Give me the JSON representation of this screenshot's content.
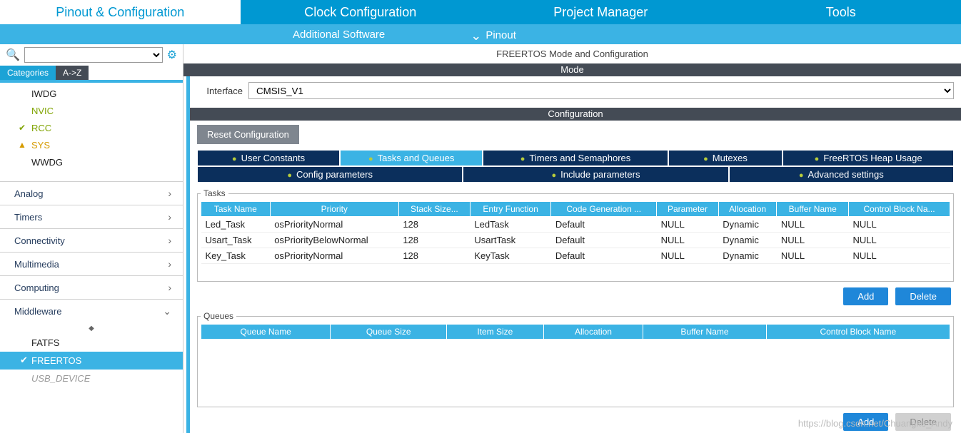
{
  "topTabs": {
    "pinout": "Pinout & Configuration",
    "clock": "Clock Configuration",
    "project": "Project Manager",
    "tools": "Tools"
  },
  "subbar": {
    "additional": "Additional Software",
    "pinout": "Pinout"
  },
  "sidebar": {
    "tabs": {
      "categories": "Categories",
      "az": "A->Z"
    },
    "sysItems": {
      "iwdg": "IWDG",
      "nvic": "NVIC",
      "rcc": "RCC",
      "sys": "SYS",
      "wwdg": "WWDG"
    },
    "categories": {
      "analog": "Analog",
      "timers": "Timers",
      "connectivity": "Connectivity",
      "multimedia": "Multimedia",
      "computing": "Computing",
      "middleware": "Middleware"
    },
    "middlewareItems": {
      "fatfs": "FATFS",
      "freertos": "FREERTOS",
      "usb": "USB_DEVICE"
    }
  },
  "content": {
    "title": "FREERTOS Mode and Configuration",
    "modeHeader": "Mode",
    "interfaceLabel": "Interface",
    "interfaceValue": "CMSIS_V1",
    "configHeader": "Configuration",
    "resetBtn": "Reset Configuration",
    "cfgTabs": {
      "userConstants": "User Constants",
      "tasksQueues": "Tasks and Queues",
      "timersSem": "Timers and Semaphores",
      "mutexes": "Mutexes",
      "heap": "FreeRTOS Heap Usage",
      "configParams": "Config parameters",
      "includeParams": "Include parameters",
      "advanced": "Advanced settings"
    },
    "tasksLegend": "Tasks",
    "tasksHeaders": [
      "Task Name",
      "Priority",
      "Stack Size...",
      "Entry Function",
      "Code Generation ...",
      "Parameter",
      "Allocation",
      "Buffer Name",
      "Control Block Na..."
    ],
    "tasks": [
      {
        "name": "Led_Task",
        "priority": "osPriorityNormal",
        "stack": "128",
        "entry": "LedTask",
        "codegen": "Default",
        "param": "NULL",
        "alloc": "Dynamic",
        "buffer": "NULL",
        "cb": "NULL"
      },
      {
        "name": "Usart_Task",
        "priority": "osPriorityBelowNormal",
        "stack": "128",
        "entry": "UsartTask",
        "codegen": "Default",
        "param": "NULL",
        "alloc": "Dynamic",
        "buffer": "NULL",
        "cb": "NULL"
      },
      {
        "name": "Key_Task",
        "priority": "osPriorityNormal",
        "stack": "128",
        "entry": "KeyTask",
        "codegen": "Default",
        "param": "NULL",
        "alloc": "Dynamic",
        "buffer": "NULL",
        "cb": "NULL"
      }
    ],
    "queuesLegend": "Queues",
    "queuesHeaders": [
      "Queue Name",
      "Queue Size",
      "Item Size",
      "Allocation",
      "Buffer Name",
      "Control Block Name"
    ],
    "addBtn": "Add",
    "deleteBtn": "Delete"
  },
  "watermark": "https://blog.csdn.net/Chuangke_Andy"
}
